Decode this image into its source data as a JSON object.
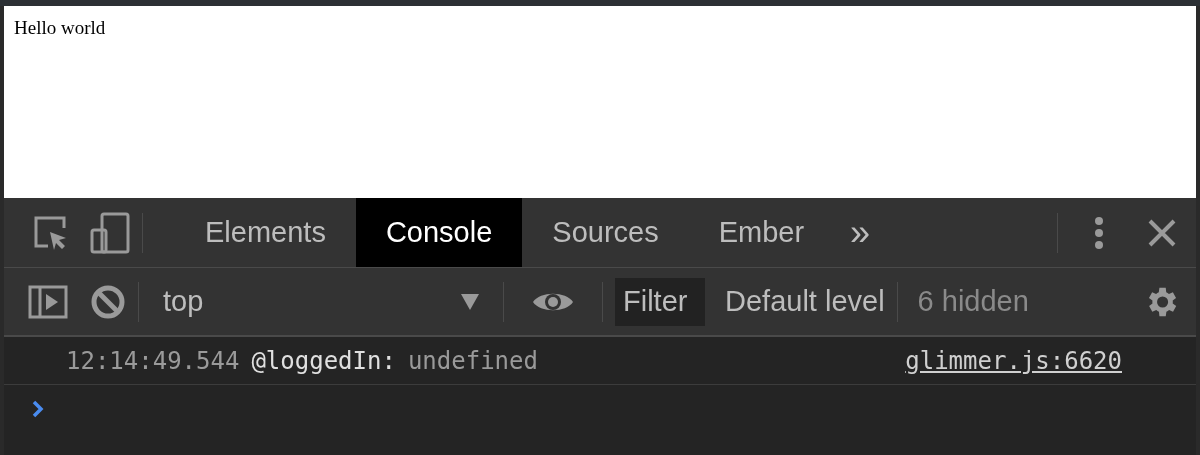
{
  "page": {
    "text": "Hello world"
  },
  "tabs": [
    {
      "label": "Elements",
      "selected": false
    },
    {
      "label": "Console",
      "selected": true
    },
    {
      "label": "Sources",
      "selected": false
    },
    {
      "label": "Ember",
      "selected": false
    }
  ],
  "more_tabs": "»",
  "toolbar": {
    "context": "top",
    "filter": {
      "placeholder": "Filter"
    },
    "levels": "Default level",
    "hidden": "6 hidden"
  },
  "messages": [
    {
      "time": "12:14:49.544",
      "label": "@loggedIn:",
      "value": "undefined",
      "source": "glimmer.js:6620"
    }
  ]
}
